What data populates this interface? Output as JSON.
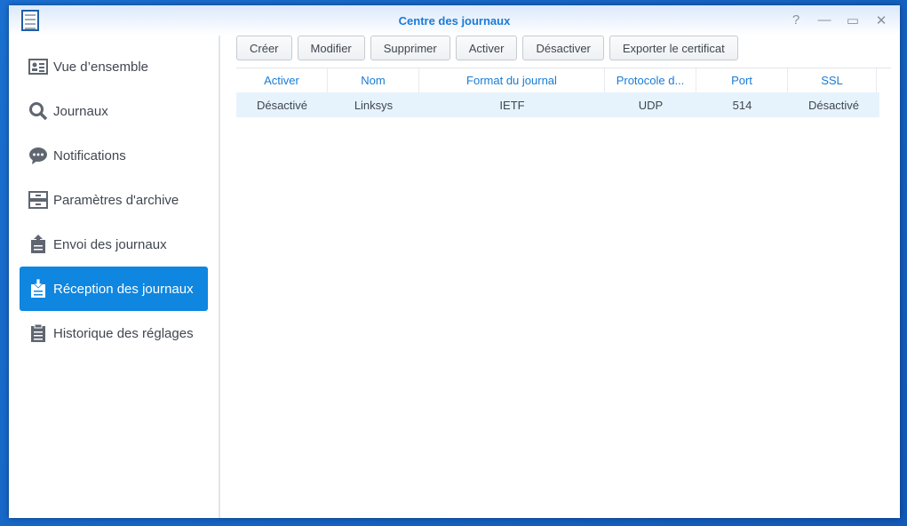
{
  "window": {
    "title": "Centre des journaux",
    "controls": [
      "?",
      "—",
      "▭",
      "✕"
    ]
  },
  "sidebar": {
    "items": [
      {
        "label": "Vue d’ensemble",
        "icon": "overview-card-icon"
      },
      {
        "label": "Journaux",
        "icon": "search-icon"
      },
      {
        "label": "Notifications",
        "icon": "chat-bubble-icon"
      },
      {
        "label": "Paramètres d'archive",
        "icon": "archive-drawer-icon"
      },
      {
        "label": "Envoi des journaux",
        "icon": "clipboard-upload-icon"
      },
      {
        "label": "Réception des journaux",
        "icon": "clipboard-download-icon",
        "selected": true
      },
      {
        "label": "Historique des réglages",
        "icon": "clipboard-list-icon"
      }
    ]
  },
  "toolbar": {
    "buttons": [
      "Créer",
      "Modifier",
      "Supprimer",
      "Activer",
      "Désactiver",
      "Exporter le certificat"
    ]
  },
  "table": {
    "columns": [
      "Activer",
      "Nom",
      "Format du journal",
      "Protocole d...",
      "Port",
      "SSL"
    ],
    "rows": [
      [
        "Désactivé",
        "Linksys",
        "IETF",
        "UDP",
        "514",
        "Désactivé"
      ]
    ]
  },
  "colors": {
    "accent": "#1a7bd6",
    "selected": "#0f86e0",
    "row_highlight": "#e6f3fd"
  }
}
